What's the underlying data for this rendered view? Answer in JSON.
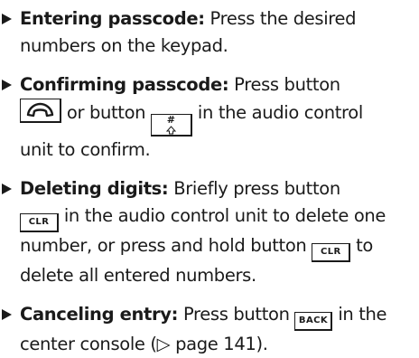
{
  "items": [
    {
      "lead": "Entering passcode:",
      "lines": [
        "Press the desired",
        "numbers on the keypad."
      ]
    },
    {
      "lead": "Confirming passcode:",
      "lines": [
        "Press button",
        "or button",
        "in the audio control",
        "unit to confirm."
      ]
    },
    {
      "lead": "Deleting digits:",
      "lines": [
        "Briefly press button",
        "in the audio control unit to delete one",
        "number, or press and hold button",
        "to",
        "delete all entered numbers."
      ]
    },
    {
      "lead": "Canceling entry:",
      "lines": [
        "Press button",
        "in the",
        "center console (▷ page 141)."
      ]
    }
  ],
  "keys": {
    "phone_icon": "phone-handset-icon",
    "hash": "#",
    "hash_icon": "up-arrow-icon",
    "clr": "CLR",
    "back": "BACK"
  }
}
